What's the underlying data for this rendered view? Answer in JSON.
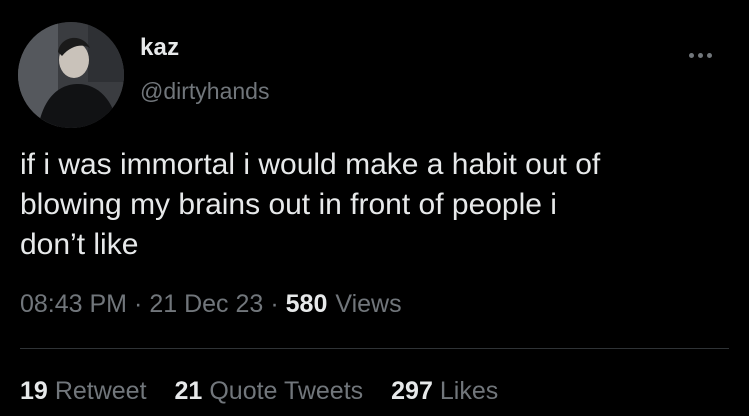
{
  "user": {
    "display_name": "kaz",
    "handle": "@dirtyhands"
  },
  "tweet": {
    "text": "if i was immortal i would make a habit out of\nblowing my brains out in front of people i\ndon’t like"
  },
  "meta": {
    "time": "08:43 PM",
    "separator_1": "·",
    "date": "21 Dec 23",
    "separator_2": "·",
    "views_count": "580",
    "views_label": "Views"
  },
  "stats": {
    "retweets_count": "19",
    "retweets_label": "Retweet",
    "quotes_count": "21",
    "quotes_label": "Quote Tweets",
    "likes_count": "297",
    "likes_label": "Likes"
  },
  "icons": {
    "more": "more-horizontal-icon"
  },
  "colors": {
    "background": "#000000",
    "primary_text": "#e7e9ea",
    "secondary_text": "#71767b",
    "divider": "#2f3336"
  }
}
